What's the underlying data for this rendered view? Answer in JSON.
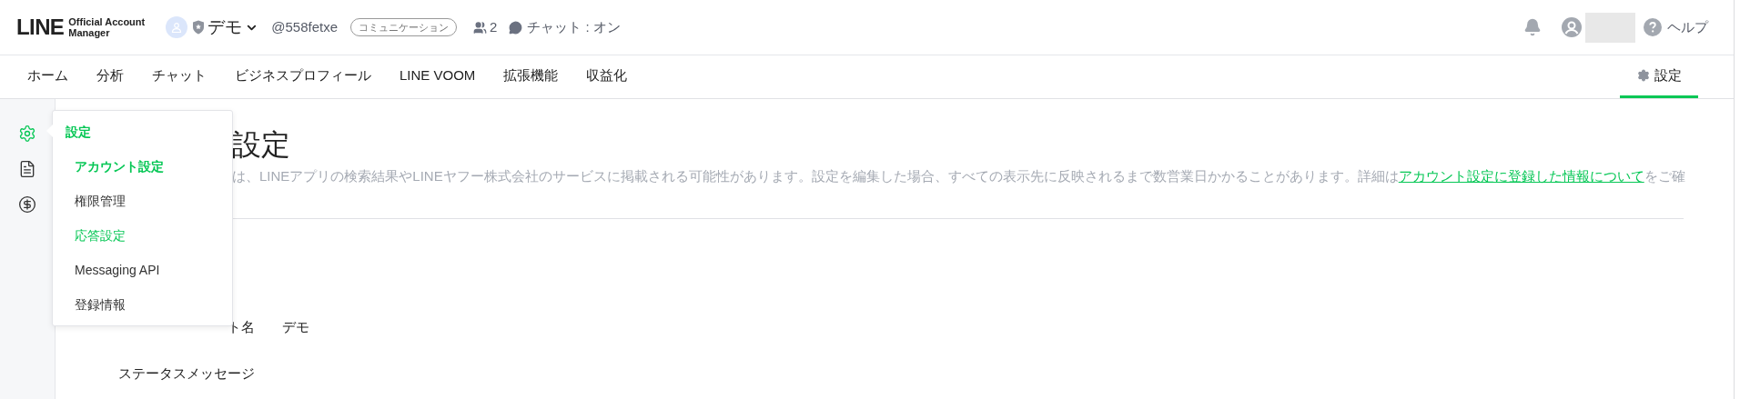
{
  "header": {
    "logo": {
      "wordmark": "LINE",
      "subtitle_1": "Official Account",
      "subtitle_2": "Manager"
    },
    "account": {
      "name": "デモ",
      "id": "@558fetxe",
      "plan_badge": "コミュニケーション",
      "friends": "2",
      "chat_status": "チャット : オン"
    },
    "help": "ヘルプ"
  },
  "nav": {
    "tabs": [
      {
        "label": "ホーム",
        "selected": false
      },
      {
        "label": "分析",
        "selected": false
      },
      {
        "label": "チャット",
        "selected": false
      },
      {
        "label": "ビジネスプロフィール",
        "selected": false
      },
      {
        "label": "LINE VOOM",
        "selected": false
      },
      {
        "label": "拡張機能",
        "selected": false
      },
      {
        "label": "収益化",
        "selected": false
      }
    ],
    "settings_tab": {
      "label": "設定",
      "selected": true
    }
  },
  "sidebar": {
    "items": [
      {
        "kind": "gear",
        "selected": true
      },
      {
        "kind": "document",
        "selected": false
      },
      {
        "kind": "dollar",
        "selected": false
      }
    ]
  },
  "flyout": {
    "title": "設定",
    "items": [
      {
        "label": "アカウント設定",
        "selected": true,
        "hovered": false
      },
      {
        "label": "権限管理",
        "selected": false,
        "hovered": false
      },
      {
        "label": "応答設定",
        "selected": false,
        "hovered": true
      },
      {
        "label": "Messaging API",
        "selected": false,
        "hovered": false
      },
      {
        "label": "登録情報",
        "selected": false,
        "hovered": false
      }
    ]
  },
  "page": {
    "title": "設定",
    "description": "は、LINEアプリの検索結果やLINEヤフー株式会社のサービスに掲載される可能性があります。設定を編集した場合、すべての表示先に反映されるまで数営業日かかることがあります。詳細は",
    "link": "アカウント設定に登録した情報について",
    "description_tail": "をご確",
    "fields": [
      {
        "label": "ト名",
        "value": "デモ"
      },
      {
        "label": "ステータスメッセージ"
      }
    ]
  }
}
